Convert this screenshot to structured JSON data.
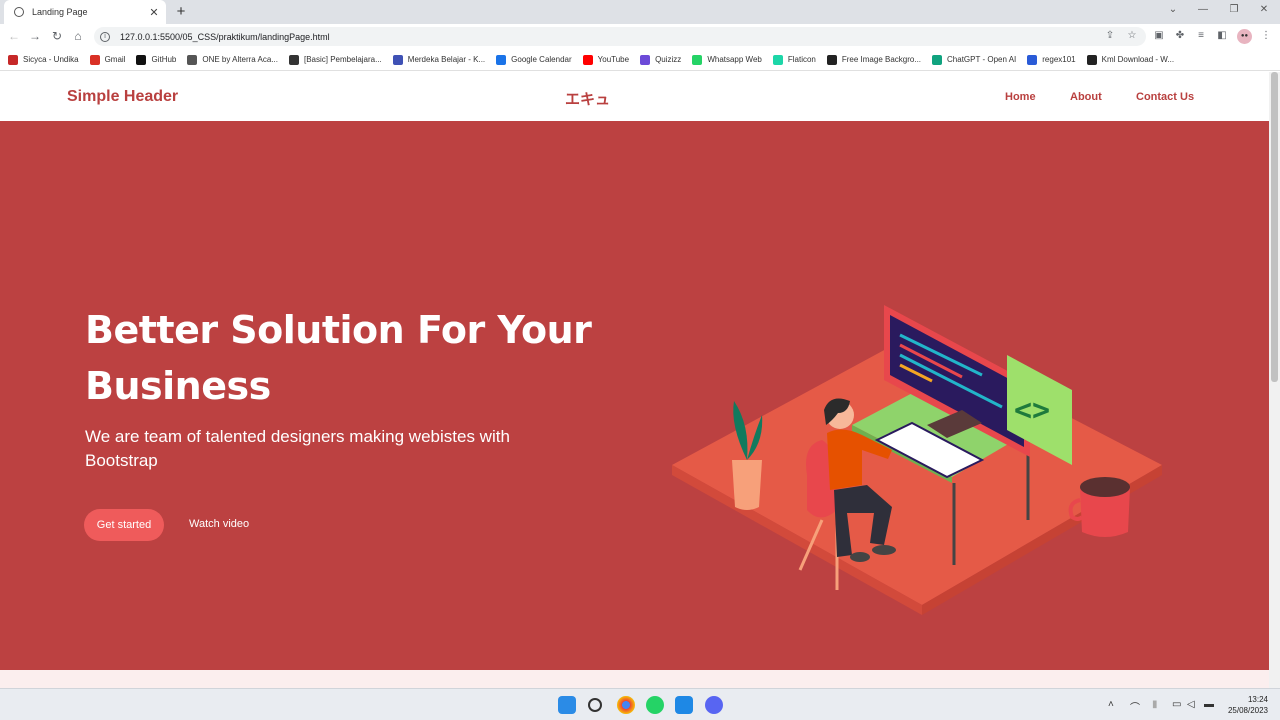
{
  "browser": {
    "tab": {
      "title": "Landing Page",
      "close": "✕"
    },
    "new_tab": "+",
    "window_controls": {
      "minimize": "—",
      "restore": "❐",
      "close": "✕",
      "dropdown": "⌄"
    },
    "address": "127.0.0.1:5500/05_CSS/praktikum/landingPage.html",
    "bookmarks": [
      {
        "label": "Sicyca - Undika",
        "color": "#c62828"
      },
      {
        "label": "Gmail",
        "color": "#d93025"
      },
      {
        "label": "GitHub",
        "color": "#111111"
      },
      {
        "label": "ONE by Alterra Aca...",
        "color": "#555555"
      },
      {
        "label": "[Basic] Pembelajara...",
        "color": "#333333"
      },
      {
        "label": "Merdeka Belajar - K...",
        "color": "#3f51b5"
      },
      {
        "label": "Google Calendar",
        "color": "#1a73e8"
      },
      {
        "label": "YouTube",
        "color": "#ff0000"
      },
      {
        "label": "Quizizz",
        "color": "#6c4ad8"
      },
      {
        "label": "Whatsapp Web",
        "color": "#25d366"
      },
      {
        "label": "Flaticon",
        "color": "#1dd6a8"
      },
      {
        "label": "Free Image Backgro...",
        "color": "#222222"
      },
      {
        "label": "ChatGPT - Open AI",
        "color": "#10a37f"
      },
      {
        "label": "regex101",
        "color": "#2a5bd7"
      },
      {
        "label": "Kml Download - W...",
        "color": "#222222"
      }
    ]
  },
  "site": {
    "brand": "Simple Header",
    "center_logo": "エキュ",
    "nav": [
      "Home",
      "About",
      "Contact Us"
    ],
    "hero": {
      "title": "Better Solution For Your Business",
      "subtitle": "We are team of talented designers making webistes with Bootstrap",
      "primary_button": "Get started",
      "secondary_button": "Watch video"
    },
    "colors": {
      "accent": "#b9403f",
      "hero_bg": "#bc4141",
      "button": "#ef5b5b"
    }
  },
  "taskbar": {
    "apps": [
      "windows-start",
      "search",
      "chrome",
      "whatsapp",
      "vscode",
      "discord"
    ],
    "time": "13:24",
    "date": "25/08/2023"
  }
}
